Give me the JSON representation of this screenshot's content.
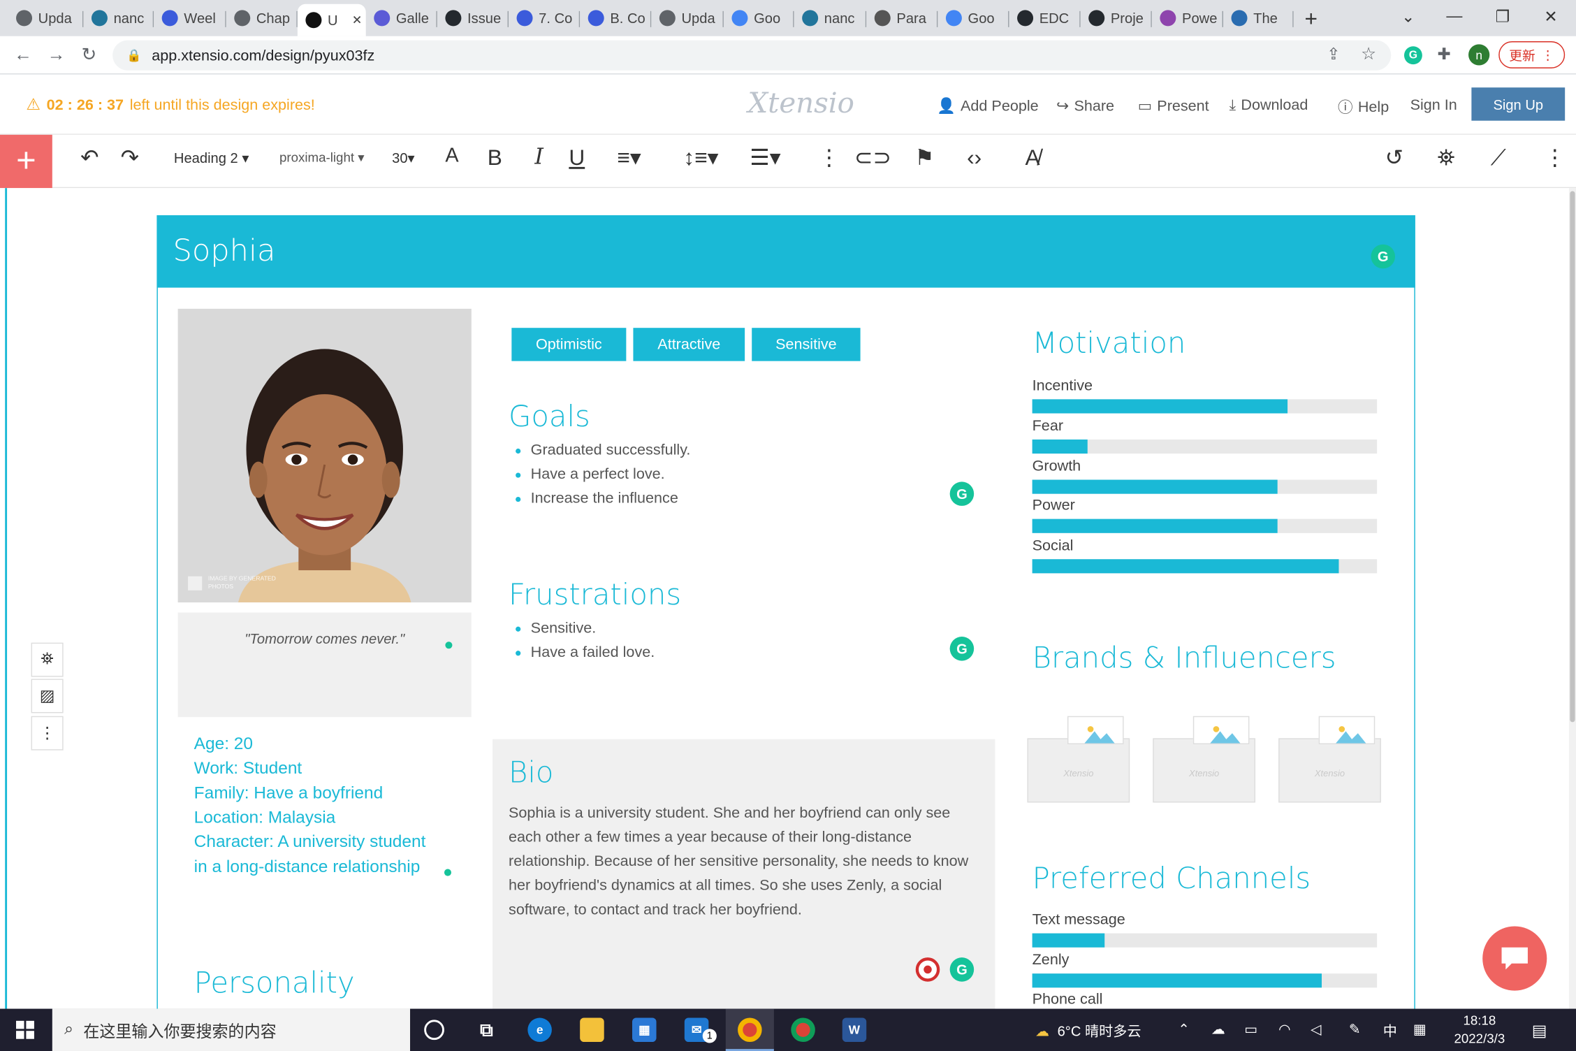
{
  "browser": {
    "tabs": [
      {
        "label": "Upda",
        "icon": "globe-icon",
        "color": "#5f6368"
      },
      {
        "label": "nanc",
        "icon": "wordpress-icon",
        "color": "#21759b"
      },
      {
        "label": "Weel",
        "icon": "cursor-icon",
        "color": "#3b5bdb"
      },
      {
        "label": "Chap",
        "icon": "globe-icon",
        "color": "#5f6368"
      },
      {
        "label": "U",
        "icon": "xtensio-icon",
        "color": "#111111",
        "active": true
      },
      {
        "label": "Galle",
        "icon": "gallery-icon",
        "color": "#5b5bd6"
      },
      {
        "label": "Issue",
        "icon": "github-icon",
        "color": "#24292e"
      },
      {
        "label": "7. Co",
        "icon": "cursor-icon",
        "color": "#3b5bdb"
      },
      {
        "label": "B. Co",
        "icon": "cursor-icon",
        "color": "#3b5bdb"
      },
      {
        "label": "Upda",
        "icon": "globe-icon",
        "color": "#5f6368"
      },
      {
        "label": "Goo",
        "icon": "translate-icon",
        "color": "#4285f4"
      },
      {
        "label": "nanc",
        "icon": "wordpress-icon",
        "color": "#21759b"
      },
      {
        "label": "Para",
        "icon": "feather-icon",
        "color": "#555555"
      },
      {
        "label": "Goo",
        "icon": "translate-icon",
        "color": "#4285f4"
      },
      {
        "label": "EDC",
        "icon": "github-icon",
        "color": "#24292e"
      },
      {
        "label": "Proje",
        "icon": "github-icon",
        "color": "#24292e"
      },
      {
        "label": "Powe",
        "icon": "power-icon",
        "color": "#8e44ad"
      },
      {
        "label": "The",
        "icon": "globe-icon",
        "color": "#2a6cb0"
      }
    ],
    "url": "app.xtensio.com/design/pyux03fz",
    "update_label": "更新",
    "profile_initial": "n"
  },
  "header": {
    "timer": "02 : 26 : 37",
    "timer_suffix": "left until this design expires!",
    "logo": "Xtensio",
    "links": [
      "Add People",
      "Share",
      "Present",
      "Download",
      "Help",
      "Sign In"
    ],
    "signup": "Sign Up"
  },
  "toolbar": {
    "style": "Heading 2",
    "font": "proxima-light",
    "size": "30"
  },
  "persona": {
    "name": "Sophia",
    "photo_credit": "IMAGE BY GENERATED PHOTOS",
    "quote": "\"Tomorrow comes never.\"",
    "info": [
      "Age: 20",
      "Work: Student",
      "Family:  Have a boyfriend",
      "Location: Malaysia",
      "Character: A university student",
      "in a long-distance relationship"
    ],
    "personality_title": "Personality",
    "tags": [
      "Optimistic",
      "Attractive",
      "Sensitive"
    ],
    "goals_title": "Goals",
    "goals": [
      "Graduated successfully.",
      "Have a perfect love.",
      "Increase the influence"
    ],
    "frustrations_title": "Frustrations",
    "frustrations": [
      "Sensitive.",
      "Have a failed love."
    ],
    "bio_title": "Bio",
    "bio": "Sophia is a university student. She and her boyfriend can only see each other a few times a year because of their long-distance relationship. Because of her sensitive personality, she needs to know her boyfriend's dynamics at all times. So she uses Zenly, a social software, to contact and track her boyfriend.",
    "motivation_title": "Motivation",
    "motivation": [
      {
        "label": "Incentive",
        "value": 0.74
      },
      {
        "label": "Fear",
        "value": 0.16
      },
      {
        "label": "Growth",
        "value": 0.71
      },
      {
        "label": "Power",
        "value": 0.71
      },
      {
        "label": "Social",
        "value": 0.89
      }
    ],
    "brands_title": "Brands & Influencers",
    "brand_placeholder": "Xtensio",
    "channels_title": "Preferred Channels",
    "channels": [
      {
        "label": "Text message",
        "value": 0.21
      },
      {
        "label": "Zenly",
        "value": 0.84
      },
      {
        "label": "Phone call",
        "value": 0.0
      }
    ]
  },
  "taskbar": {
    "search_placeholder": "在这里输入你要搜索的内容",
    "weather": "6°C 晴时多云",
    "ime": "中",
    "time": "18:18",
    "date": "2022/3/3",
    "mail_badge": "1"
  }
}
